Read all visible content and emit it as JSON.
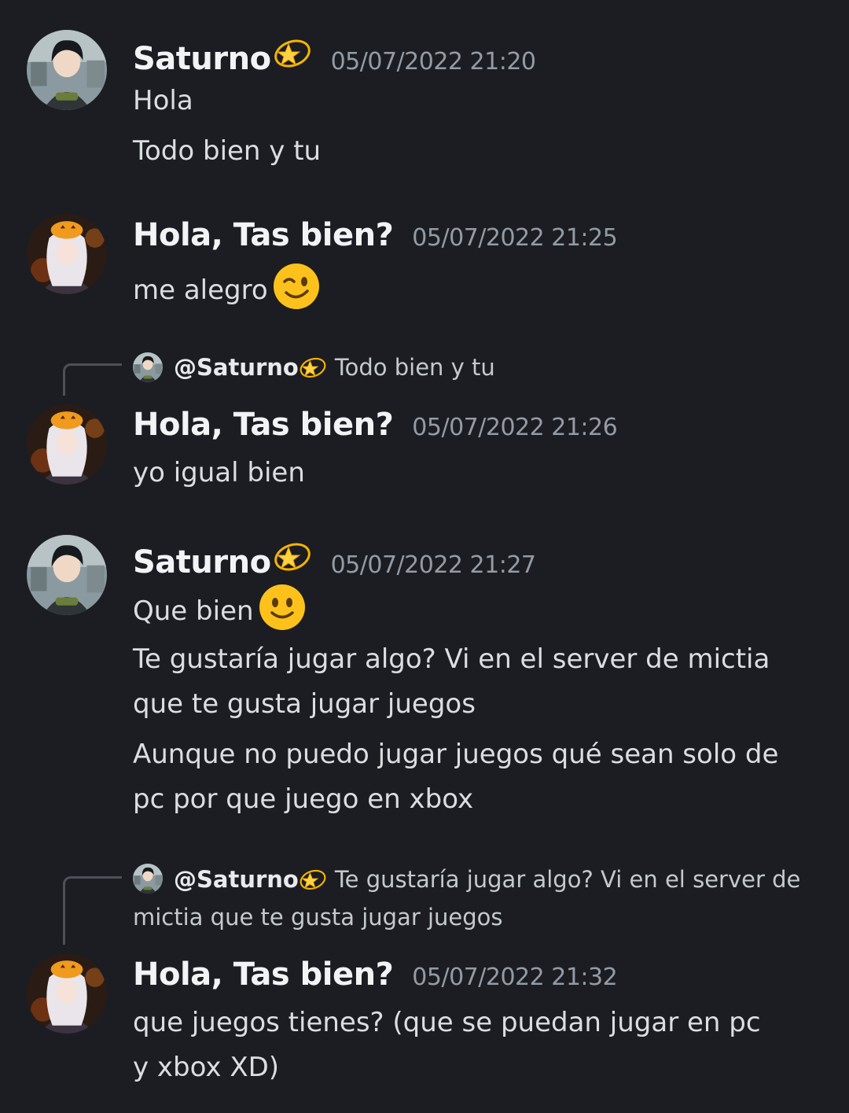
{
  "colors": {
    "background": "#1c1d22",
    "username": "#f2f3f5",
    "timestamp": "#949ba4",
    "message_text": "#dbdee1",
    "reply_spine": "#4e5058"
  },
  "icons": {
    "name_decoration": "dizzy-star-emoji",
    "wink": "winking-face-emoji",
    "smile": "slightly-smiling-face-emoji"
  },
  "messages": [
    {
      "author": "Saturno",
      "timestamp": "05/07/2022 21:20",
      "lines": [
        "Hola",
        "Todo bien y tu"
      ]
    },
    {
      "author": "Hola, Tas bien?",
      "timestamp": "05/07/2022 21:25",
      "lines": [
        "me alegro"
      ]
    },
    {
      "reply_to": {
        "mention": "@Saturno",
        "excerpt": "Todo bien y tu"
      },
      "author": "Hola, Tas bien?",
      "timestamp": "05/07/2022 21:26",
      "lines": [
        "yo igual bien"
      ]
    },
    {
      "author": "Saturno",
      "timestamp": "05/07/2022 21:27",
      "lines": [
        "Que bien",
        "Te gustaría jugar algo? Vi en el server de mictia que te gusta jugar juegos",
        "Aunque no puedo jugar juegos qué sean solo de pc por que juego en xbox"
      ]
    },
    {
      "reply_to": {
        "mention": "@Saturno",
        "excerpt": "Te gustaría jugar algo? Vi en el server de mictia que te gusta jugar juegos"
      },
      "author": "Hola, Tas bien?",
      "timestamp": "05/07/2022 21:32",
      "lines": [
        "que juegos tienes? (que se puedan jugar en pc y xbox XD)"
      ]
    }
  ]
}
